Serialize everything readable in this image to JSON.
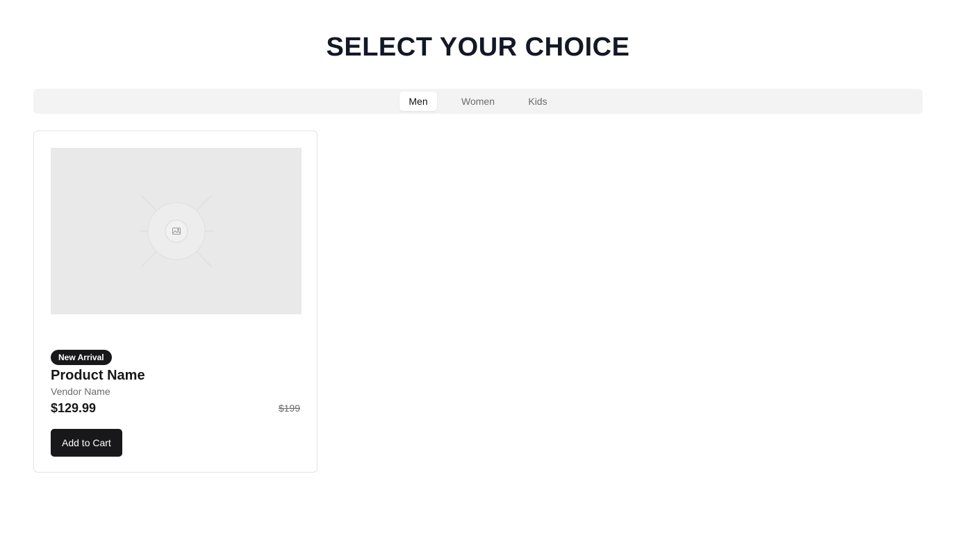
{
  "page": {
    "title": "SELECT YOUR CHOICE"
  },
  "tabs": [
    {
      "label": "Men",
      "active": true
    },
    {
      "label": "Women",
      "active": false
    },
    {
      "label": "Kids",
      "active": false
    }
  ],
  "product": {
    "image_icon": "image-placeholder-icon",
    "badge": "New Arrival",
    "name": "Product Name",
    "vendor": "Vendor Name",
    "price": "$129.99",
    "original_price": "$199",
    "add_to_cart_label": "Add to Cart"
  },
  "colors": {
    "accent": "#18181b",
    "tab_bar_bg": "#f3f3f3",
    "image_bg": "#e9e9e9"
  }
}
